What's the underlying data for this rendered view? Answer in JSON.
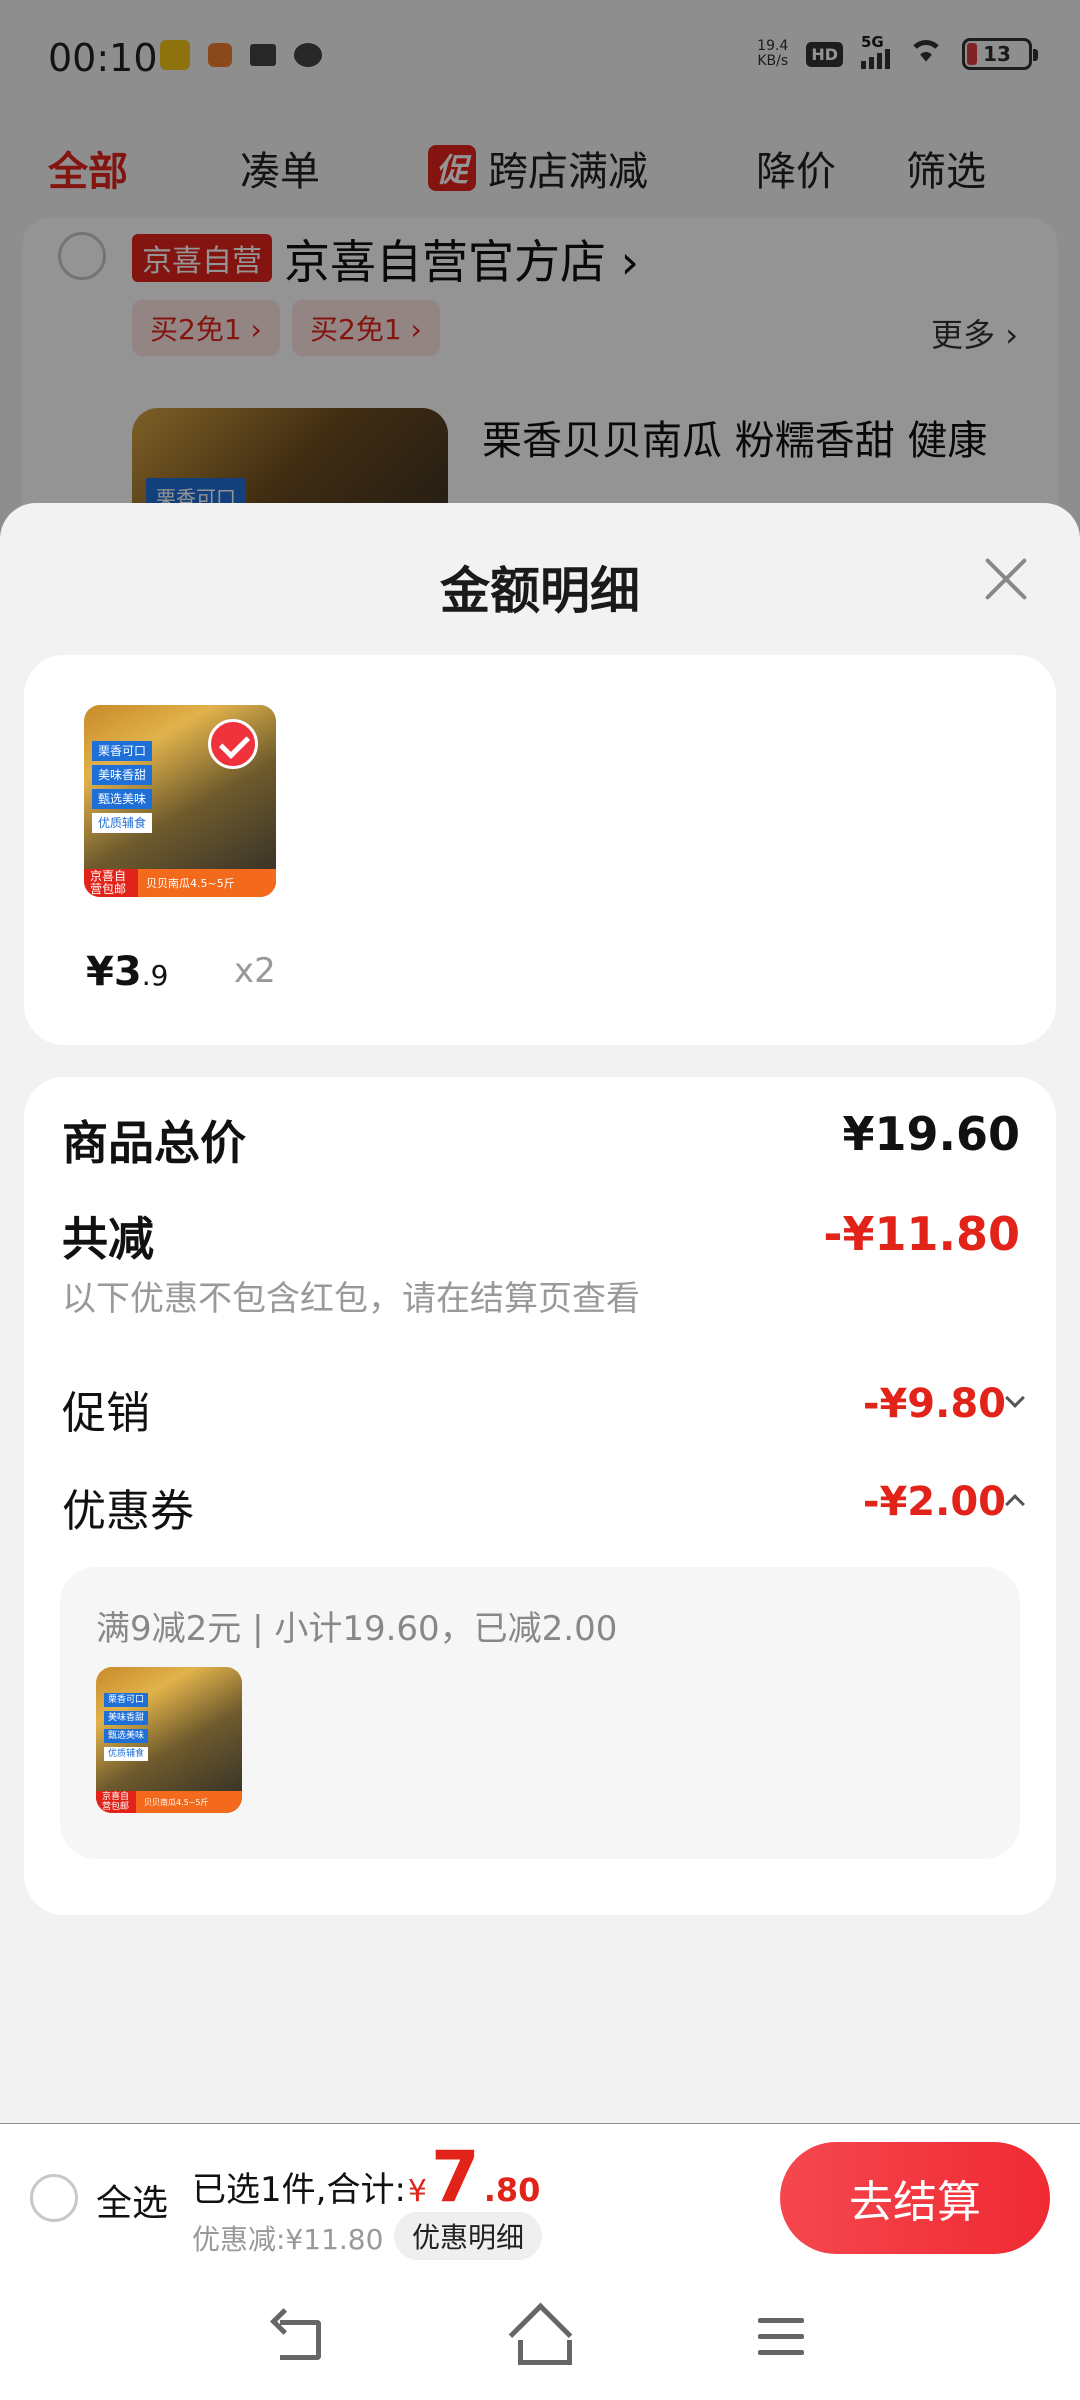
{
  "status_bar": {
    "time": "00:10",
    "net_speed_value": "19.4",
    "net_speed_unit": "KB/s",
    "hd": "HD",
    "network": "5G",
    "battery": "13"
  },
  "filter_tabs": {
    "all": "全部",
    "bundle": "凑单",
    "promo_badge": "促",
    "cross_store": "跨店满减",
    "price_drop": "降价",
    "filter": "筛选"
  },
  "background_store": {
    "badge": "京喜自营",
    "name": "京喜自营官方店",
    "deals": [
      "买2免1",
      "买2免1"
    ],
    "more": "更多",
    "thumb_tag": "栗香可口",
    "product_title": "栗香贝贝南瓜 粉糯香甜 健康"
  },
  "sheet": {
    "title": "金额明细",
    "item": {
      "price_symbol": "¥",
      "price_int": "3",
      "price_dec": ".9",
      "quantity": "x2",
      "image_labels": [
        "栗香可口",
        "美味香甜",
        "甄选美味",
        "优质辅食"
      ],
      "image_footer_badge": "京喜自营包邮",
      "image_footer_spec": "贝贝南瓜4.5~5斤"
    },
    "total_label": "商品总价",
    "total_value": "¥19.60",
    "reduction_label": "共减",
    "reduction_value": "-¥11.80",
    "reduction_note": "以下优惠不包含红包，请在结算页查看",
    "promotion_label": "促销",
    "promotion_value": "-¥9.80",
    "coupon_label": "优惠券",
    "coupon_value": "-¥2.00",
    "coupon_detail": "满9减2元 | 小计19.60，已减2.00"
  },
  "bottom_bar": {
    "select_all": "全选",
    "selected_text": "已选1件,合计:",
    "total_symbol": "¥",
    "total_int": "7",
    "total_dec": ".80",
    "discount_text": "优惠减:¥11.80",
    "detail_chip": "优惠明细",
    "checkout": "去结算"
  },
  "colors": {
    "accent_red": "#e2231a",
    "checkout_red": "#f02a33",
    "promo_blue": "#1f6fd8"
  }
}
